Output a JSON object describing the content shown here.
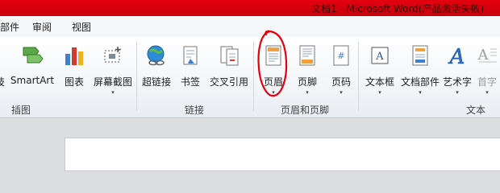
{
  "window": {
    "title": "文档1 - Microsoft Word(产品激活失败)"
  },
  "menu": {
    "tabs": [
      "部件",
      "审阅",
      "视图"
    ]
  },
  "ribbon": {
    "buttons": {
      "partial_left": "技",
      "smartart": "SmartArt",
      "chart": "图表",
      "screenshot": "屏幕截图",
      "hyperlink": "超链接",
      "bookmark": "书签",
      "crossref": "交叉引用",
      "header": "页眉",
      "footer": "页脚",
      "pagenum": "页码",
      "textbox": "文本框",
      "quickparts": "文档部件",
      "wordart": "艺术字",
      "dropcap": "首字"
    },
    "groups": {
      "illustrations": "插图",
      "links": "链接",
      "header_footer": "页眉和页脚",
      "text": "文本"
    },
    "dropdown_arrow": "▾"
  },
  "colors": {
    "titlebar": "#d9000e",
    "annotation": "#e4000f"
  }
}
